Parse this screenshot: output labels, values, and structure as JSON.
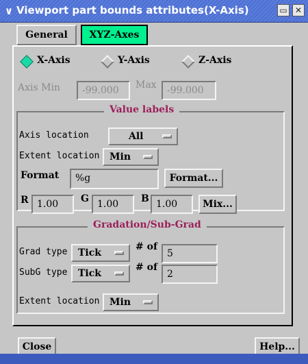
{
  "window": {
    "title": "Viewport part bounds attributes(X-Axis)",
    "menu_icon": "chevron-down-icon",
    "minimize_glyph": "▭",
    "close_glyph": "✕"
  },
  "tabs": [
    {
      "label": "General",
      "active": false
    },
    {
      "label": "XYZ-Axes",
      "active": true
    }
  ],
  "axis_select": {
    "options": [
      {
        "label": "X-Axis",
        "selected": true
      },
      {
        "label": "Y-Axis",
        "selected": false
      },
      {
        "label": "Z-Axis",
        "selected": false
      }
    ]
  },
  "axis_range": {
    "min_label": "Axis Min",
    "min_value": "-99.000",
    "max_label": "Max",
    "max_value": "-99.000"
  },
  "value_labels": {
    "title": "Value labels",
    "axis_location_label": "Axis location",
    "axis_location_value": "All",
    "extent_location_label": "Extent location",
    "extent_location_value": "Min",
    "format_label": "Format",
    "format_value": "%g",
    "format_button": "Format...",
    "r_label": "R",
    "r_value": "1.00",
    "g_label": "G",
    "g_value": "1.00",
    "b_label": "B",
    "b_value": "1.00",
    "mix_button": "Mix..."
  },
  "gradation": {
    "title": "Gradation/Sub-Grad",
    "grad_type_label": "Grad type",
    "grad_type_value": "Tick",
    "grad_count_label": "# of",
    "grad_count_value": "5",
    "subg_type_label": "SubG type",
    "subg_type_value": "Tick",
    "subg_count_label": "# of",
    "subg_count_value": "2",
    "extent_location_label": "Extent location",
    "extent_location_value": "Min"
  },
  "footer": {
    "close_button": "Close",
    "help_button": "Help..."
  },
  "colors": {
    "active_tab": "#00f090",
    "radio_selected": "#1dd9a8",
    "group_title": "#9a1f5a",
    "titlebar": "#4d6fd0"
  }
}
